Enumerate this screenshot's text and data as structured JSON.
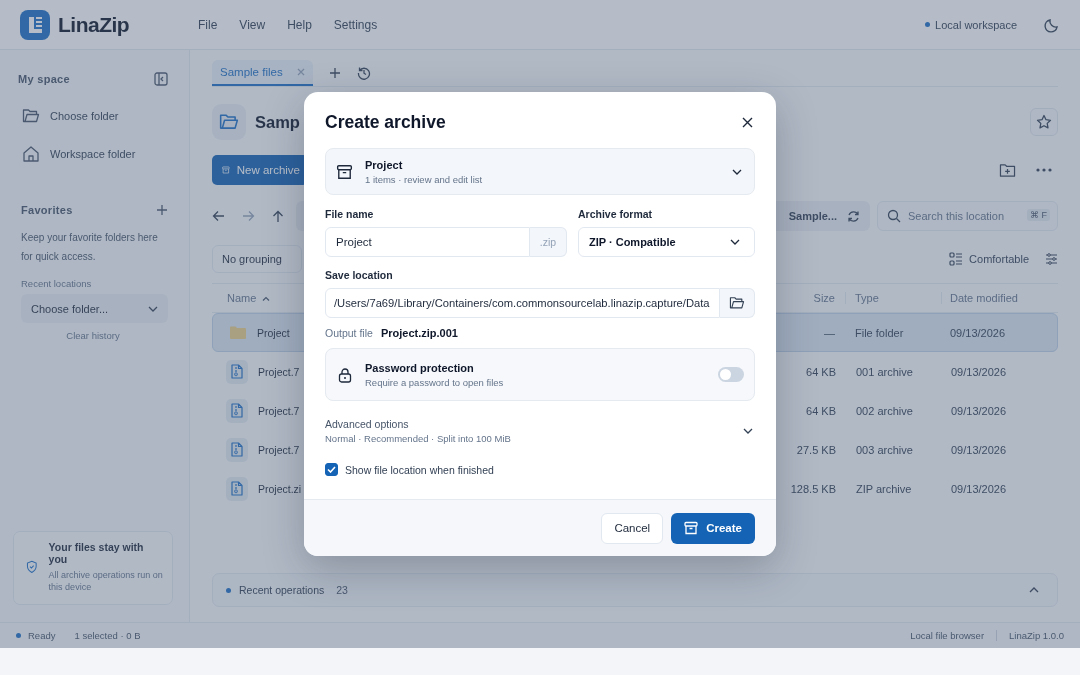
{
  "app": {
    "name": "LinaZip"
  },
  "menu": [
    "File",
    "View",
    "Help",
    "Settings"
  ],
  "workspace": {
    "label": "Local workspace"
  },
  "sidebar": {
    "title": "My space",
    "items": [
      {
        "label": "Choose folder",
        "kind": "folder"
      },
      {
        "label": "Workspace folder",
        "kind": "home"
      }
    ],
    "favorites": {
      "title": "Favorites",
      "hint": "Keep your favorite folders here for quick access."
    },
    "recent": {
      "label": "Recent locations",
      "value": "Choose folder...",
      "clear": "Clear history"
    },
    "notice": {
      "title": "Your files stay with you",
      "text": "All archive operations run on this device"
    }
  },
  "tabs": [
    {
      "label": "Sample files",
      "selected": true
    }
  ],
  "location": {
    "title": "Samp"
  },
  "toolbar": {
    "new_archive": "New archive",
    "breadcrumb": "Sample...",
    "search": {
      "placeholder": "Search this location",
      "shortcut": "⌘ F"
    }
  },
  "grouping": "No grouping",
  "density": "Comfortable",
  "table": {
    "columns": [
      {
        "label": "Name",
        "sorted": true
      },
      {
        "label": "Size",
        "sorted": false
      },
      {
        "label": "Type",
        "sorted": false
      },
      {
        "label": "Date modified",
        "sorted": false
      }
    ],
    "rows": [
      {
        "name": "Project",
        "kind": "folder",
        "size": "—",
        "type": "File folder",
        "date": "09/13/2026",
        "selected": true
      },
      {
        "name": "Project.7",
        "kind": "archive",
        "size": "64 KB",
        "type": "001 archive",
        "date": "09/13/2026",
        "selected": false
      },
      {
        "name": "Project.7",
        "kind": "archive",
        "size": "64 KB",
        "type": "002 archive",
        "date": "09/13/2026",
        "selected": false
      },
      {
        "name": "Project.7",
        "kind": "archive",
        "size": "27.5 KB",
        "type": "003 archive",
        "date": "09/13/2026",
        "selected": false
      },
      {
        "name": "Project.zi",
        "kind": "archive",
        "size": "128.5 KB",
        "type": "ZIP archive",
        "date": "09/13/2026",
        "selected": false
      }
    ]
  },
  "recent_operations": {
    "label": "Recent operations",
    "count": "23"
  },
  "status_bar": {
    "state": "Ready",
    "selection": "1 selected · 0 B",
    "right": [
      "Local file browser",
      "LinaZip 1.0.0"
    ]
  },
  "dialog": {
    "title": "Create archive",
    "source": {
      "name": "Project",
      "detail": "1 items · review and edit list"
    },
    "file_name": {
      "label": "File name",
      "value": "Project",
      "extension": ".zip"
    },
    "format": {
      "label": "Archive format",
      "value": "ZIP · Compatible"
    },
    "save_location": {
      "label": "Save location",
      "value": "/Users/7a69/Library/Containers/com.commonsourcelab.linazip.capture/Data"
    },
    "output": {
      "label": "Output file",
      "value": "Project.zip.001"
    },
    "password": {
      "title": "Password protection",
      "detail": "Require a password to open files",
      "on": false
    },
    "advanced": {
      "title": "Advanced options",
      "detail": "Normal · Recommended · Split into 100 MiB",
      "expanded": false
    },
    "show_location": {
      "label": "Show file location when finished",
      "checked": true
    },
    "buttons": {
      "cancel": "Cancel",
      "create": "Create"
    }
  }
}
